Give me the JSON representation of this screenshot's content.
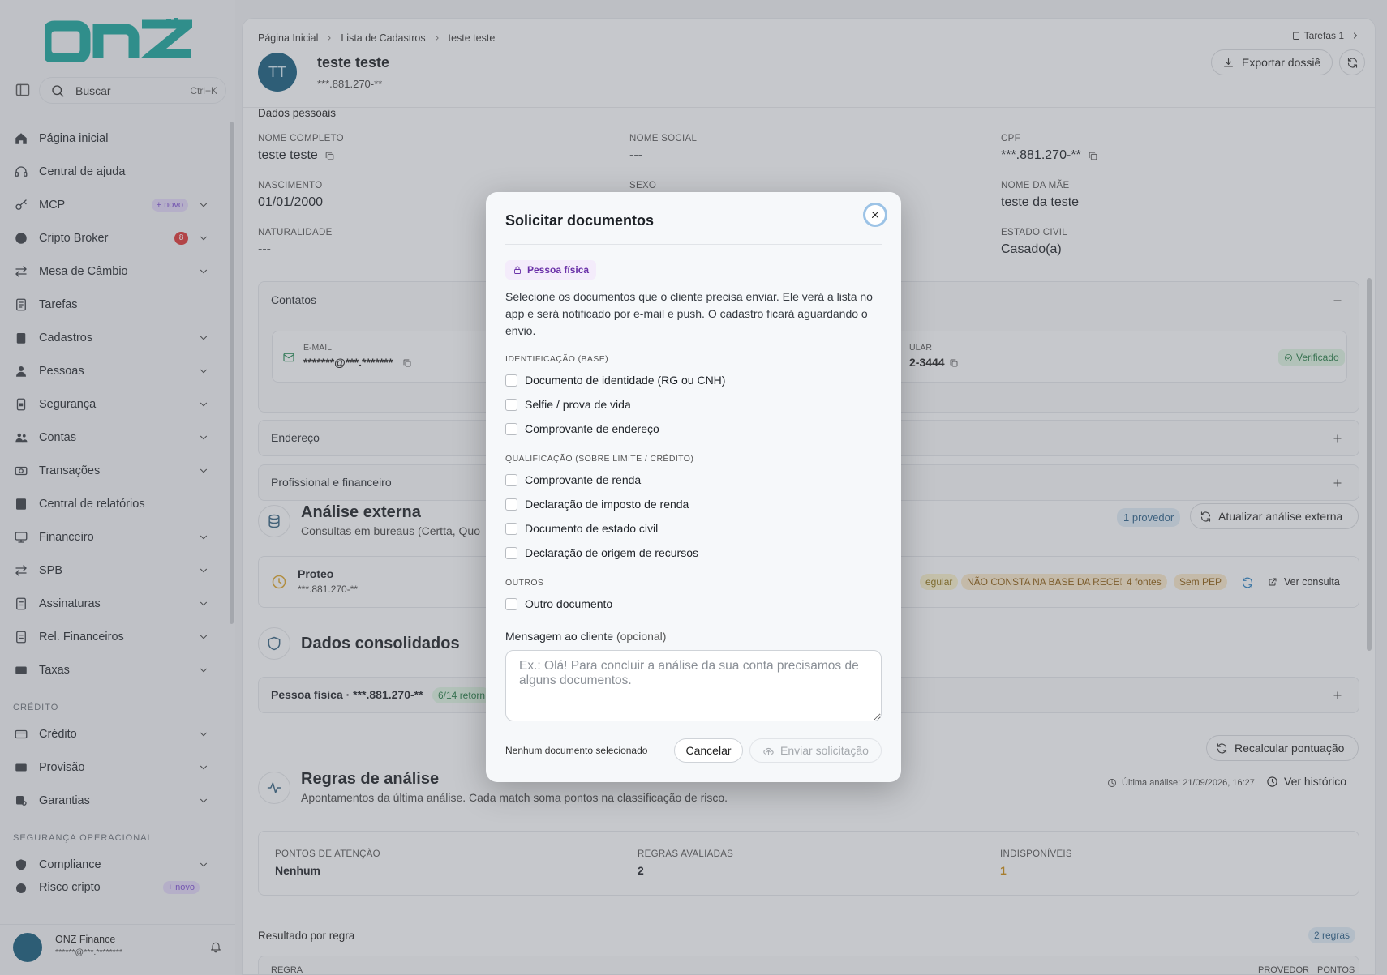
{
  "brand": {
    "logo_text": "onz",
    "color": "#1aa39a"
  },
  "sidebar": {
    "search_label": "Buscar",
    "search_shortcut": "Ctrl+K",
    "items": [
      {
        "label": "Página inicial",
        "icon": "home-icon"
      },
      {
        "label": "Central de ajuda",
        "icon": "headset-icon"
      },
      {
        "label": "MCP",
        "icon": "key-icon",
        "badge": "+ novo",
        "chevron": true
      },
      {
        "label": "Cripto Broker",
        "icon": "bitcoin-icon",
        "badge_count": "8",
        "chevron": true
      },
      {
        "label": "Mesa de Câmbio",
        "icon": "arrows-icon",
        "chevron": true
      },
      {
        "label": "Tarefas",
        "icon": "tasks-icon"
      },
      {
        "label": "Cadastros",
        "icon": "clipboard-icon",
        "chevron": true
      },
      {
        "label": "Pessoas",
        "icon": "person-icon",
        "chevron": true
      },
      {
        "label": "Segurança",
        "icon": "shield-icon",
        "chevron": true
      },
      {
        "label": "Contas",
        "icon": "users-icon",
        "chevron": true
      },
      {
        "label": "Transações",
        "icon": "cash-icon",
        "chevron": true
      },
      {
        "label": "Central de relatórios",
        "icon": "report-icon"
      },
      {
        "label": "Financeiro",
        "icon": "monitor-icon",
        "chevron": true
      },
      {
        "label": "SPB",
        "icon": "transfer-icon",
        "chevron": true
      },
      {
        "label": "Assinaturas",
        "icon": "signature-icon",
        "chevron": true
      },
      {
        "label": "Rel. Financeiros",
        "icon": "doc-icon",
        "chevron": true
      },
      {
        "label": "Taxas",
        "icon": "money-icon",
        "chevron": true
      }
    ],
    "section_credito": "CRÉDITO",
    "credito_items": [
      {
        "label": "Crédito",
        "icon": "card-icon"
      },
      {
        "label": "Provisão",
        "icon": "cash-icon"
      },
      {
        "label": "Garantias",
        "icon": "guarantee-icon"
      }
    ],
    "section_seguranca": "SEGURANÇA OPERACIONAL",
    "seg_items": [
      {
        "label": "Compliance",
        "icon": "shield-check-icon"
      },
      {
        "label": "Risco cripto",
        "icon": "risk-icon",
        "badge": "+ novo"
      }
    ],
    "user_name": "ONZ Finance",
    "user_email": "******@***.********"
  },
  "header": {
    "breadcrumbs": [
      "Página Inicial",
      "Lista de Cadastros",
      "teste teste"
    ],
    "tasks_label": "Tarefas 1",
    "initials": "TT",
    "name": "teste teste",
    "cpf": "***.881.270-**",
    "export_label": "Exportar dossiê"
  },
  "personal": {
    "section": "Dados pessoais",
    "fields": [
      {
        "label": "NOME COMPLETO",
        "value": "teste teste"
      },
      {
        "label": "NOME SOCIAL",
        "value": "---"
      },
      {
        "label": "CPF",
        "value": "***.881.270-**"
      },
      {
        "label": "NASCIMENTO",
        "value": "01/01/2000"
      },
      {
        "label": "SEXO",
        "value": ""
      },
      {
        "label": "NOME DA MÃE",
        "value": "teste da teste"
      },
      {
        "label": "NATURALIDADE",
        "value": "---"
      },
      {
        "label": "ESTADO CIVIL",
        "value": "Casado(a)"
      }
    ]
  },
  "contacts": {
    "title": "Contatos",
    "email_label": "E-MAIL",
    "email_value": "*******@***.*******",
    "phone_label": "ULAR",
    "phone_value": "2-3444",
    "verified": "Verificado"
  },
  "address": {
    "title": "Endereço"
  },
  "professional": {
    "title": "Profissional e financeiro"
  },
  "external": {
    "title": "Análise externa",
    "subtitle": "Consultas em bureaus (Certta, Quo",
    "providers": "1 provedor",
    "update_label": "Atualizar análise externa",
    "row_name": "Proteo",
    "row_cpf": "***.881.270-**",
    "chip1": "egular",
    "chip2": "NÃO CONSTA NA BASE DA RECEI...",
    "chip3": "4 fontes",
    "chip4": "Sem PEP",
    "view_label": "Ver consulta"
  },
  "consolidated": {
    "title": "Dados consolidados",
    "row": "Pessoa física · ***.881.270-**",
    "chip": "6/14 retorn"
  },
  "recalc_label": "Recalcular pontuação",
  "rules": {
    "title": "Regras de análise",
    "subtitle": "Apontamentos da última análise. Cada match soma pontos na classificação de risco.",
    "last": "Última análise: 21/09/2026, 16:27",
    "history": "Ver histórico",
    "stats": [
      {
        "label": "PONTOS DE ATENÇÃO",
        "value": "Nenhum"
      },
      {
        "label": "REGRAS AVALIADAS",
        "value": "2"
      },
      {
        "label": "INDISPONÍVEIS",
        "value": "1"
      }
    ],
    "result_title": "Resultado por regra",
    "result_count": "2 regras",
    "col_rule": "REGRA",
    "col_provider": "PROVEDOR",
    "col_points": "PONTOS"
  },
  "modal": {
    "title": "Solicitar documentos",
    "chip": "Pessoa física",
    "description": "Selecione os documentos que o cliente precisa enviar. Ele verá a lista no app e será notificado por e-mail e push. O cadastro ficará aguardando o envio.",
    "sections": [
      {
        "title": "IDENTIFICAÇÃO (BASE)",
        "items": [
          "Documento de identidade (RG ou CNH)",
          "Selfie / prova de vida",
          "Comprovante de endereço"
        ]
      },
      {
        "title": "QUALIFICAÇÃO (SOBRE LIMITE / CRÉDITO)",
        "items": [
          "Comprovante de renda",
          "Declaração de imposto de renda",
          "Documento de estado civil",
          "Declaração de origem de recursos"
        ]
      },
      {
        "title": "OUTROS",
        "items": [
          "Outro documento"
        ]
      }
    ],
    "message_label": "Mensagem ao cliente",
    "message_optional": "(opcional)",
    "message_placeholder": "Ex.: Olá! Para concluir a análise da sua conta precisamos de alguns documentos.",
    "status": "Nenhum documento selecionado",
    "cancel": "Cancelar",
    "send": "Enviar solicitação"
  }
}
